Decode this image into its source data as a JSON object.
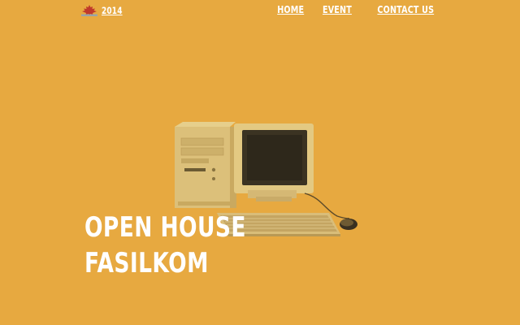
{
  "header": {
    "logo_year": "2014",
    "nav": [
      {
        "label": "HOME"
      },
      {
        "label": "EVENT"
      },
      {
        "label": "CONTACT US"
      }
    ]
  },
  "hero": {
    "title_line1": "OPEN HOUSE",
    "title_line2": "FASILKOM",
    "illustration_icon": "desktop-computer-icon"
  },
  "colors": {
    "background": "#E7A940",
    "text": "#ffffff",
    "logo_red": "#C0392B"
  }
}
